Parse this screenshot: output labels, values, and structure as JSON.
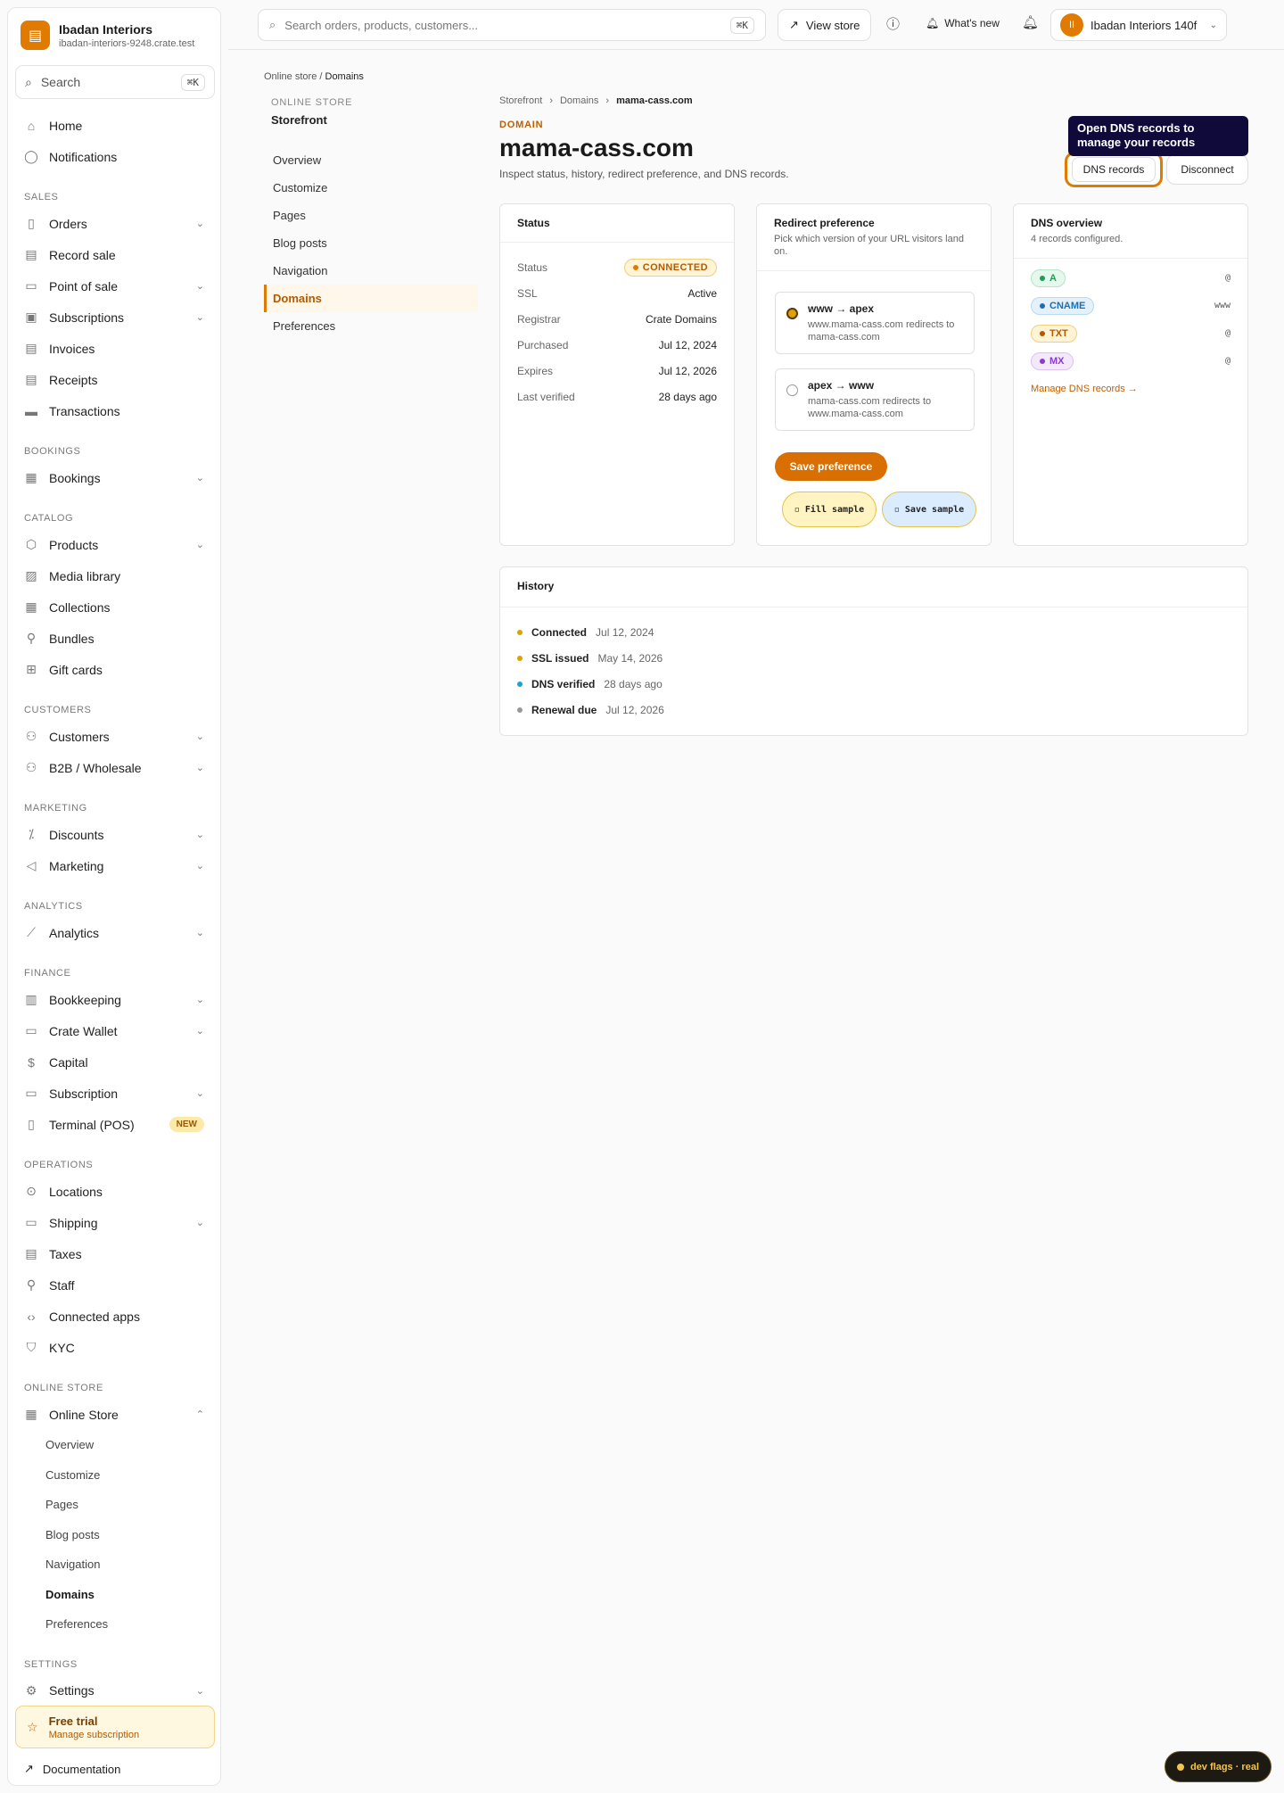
{
  "brand": {
    "name": "Ibadan Interiors",
    "subdomain": "ibadan-interiors-9248.crate.test",
    "logo_icon": "store-icon"
  },
  "sidebar_search": {
    "placeholder": "Search",
    "shortcut": "⌘K"
  },
  "sidebar": {
    "top": [
      {
        "label": "Home",
        "icon": "home-icon"
      },
      {
        "label": "Notifications",
        "icon": "bell-icon"
      }
    ],
    "sections": [
      {
        "title": "SALES",
        "items": [
          {
            "label": "Orders",
            "icon": "orders-icon",
            "chevron": true
          },
          {
            "label": "Record sale",
            "icon": "receipt-icon"
          },
          {
            "label": "Point of sale",
            "icon": "pos-icon",
            "chevron": true
          },
          {
            "label": "Subscriptions",
            "icon": "subscriptions-icon",
            "chevron": true
          },
          {
            "label": "Invoices",
            "icon": "invoice-icon"
          },
          {
            "label": "Receipts",
            "icon": "receipt-icon"
          },
          {
            "label": "Transactions",
            "icon": "transactions-icon"
          }
        ]
      },
      {
        "title": "BOOKINGS",
        "items": [
          {
            "label": "Bookings",
            "icon": "calendar-icon",
            "chevron": true
          }
        ]
      },
      {
        "title": "CATALOG",
        "items": [
          {
            "label": "Products",
            "icon": "box-icon",
            "chevron": true
          },
          {
            "label": "Media library",
            "icon": "image-icon"
          },
          {
            "label": "Collections",
            "icon": "grid-icon"
          },
          {
            "label": "Bundles",
            "icon": "bundle-icon"
          },
          {
            "label": "Gift cards",
            "icon": "gift-icon"
          }
        ]
      },
      {
        "title": "CUSTOMERS",
        "items": [
          {
            "label": "Customers",
            "icon": "users-icon",
            "chevron": true
          },
          {
            "label": "B2B / Wholesale",
            "icon": "users-icon",
            "chevron": true
          }
        ]
      },
      {
        "title": "MARKETING",
        "items": [
          {
            "label": "Discounts",
            "icon": "discount-icon",
            "chevron": true
          },
          {
            "label": "Marketing",
            "icon": "megaphone-icon",
            "chevron": true
          }
        ]
      },
      {
        "title": "ANALYTICS",
        "items": [
          {
            "label": "Analytics",
            "icon": "chart-icon",
            "chevron": true
          }
        ]
      },
      {
        "title": "FINANCE",
        "items": [
          {
            "label": "Bookkeeping",
            "icon": "ledger-icon",
            "chevron": true
          },
          {
            "label": "Crate Wallet",
            "icon": "wallet-icon",
            "chevron": true
          },
          {
            "label": "Capital",
            "icon": "dollar-icon"
          },
          {
            "label": "Subscription",
            "icon": "card-icon",
            "chevron": true
          },
          {
            "label": "Terminal (POS)",
            "icon": "terminal-icon",
            "badge": "NEW"
          }
        ]
      },
      {
        "title": "OPERATIONS",
        "items": [
          {
            "label": "Locations",
            "icon": "pin-icon"
          },
          {
            "label": "Shipping",
            "icon": "truck-icon",
            "chevron": true
          },
          {
            "label": "Taxes",
            "icon": "tax-icon"
          },
          {
            "label": "Staff",
            "icon": "user-plus-icon"
          },
          {
            "label": "Connected apps",
            "icon": "code-icon"
          },
          {
            "label": "KYC",
            "icon": "shield-icon"
          }
        ]
      },
      {
        "title": "ONLINE STORE",
        "items": [
          {
            "label": "Online Store",
            "icon": "storefront-icon",
            "chevron_up": true
          }
        ]
      }
    ],
    "online_store_sub": [
      "Overview",
      "Customize",
      "Pages",
      "Blog posts",
      "Navigation",
      "Domains",
      "Preferences"
    ],
    "settings": {
      "title": "SETTINGS",
      "label": "Settings",
      "icon": "gear-icon"
    }
  },
  "trial": {
    "title": "Free trial",
    "subtitle": "Manage subscription"
  },
  "docs": {
    "label": "Documentation"
  },
  "topbar": {
    "search_placeholder": "Search orders, products, customers...",
    "search_shortcut": "⌘K",
    "view_store": "View store",
    "whats_new": "What's new",
    "account": "Ibadan Interiors 140f",
    "avatar": "II"
  },
  "breadcrumb_top": {
    "parent": "Online store",
    "sep": "/",
    "current": "Domains"
  },
  "subnav": {
    "eyebrow": "ONLINE STORE",
    "title": "Storefront",
    "items": [
      "Overview",
      "Customize",
      "Pages",
      "Blog posts",
      "Navigation",
      "Domains",
      "Preferences"
    ],
    "active": "Domains"
  },
  "breadcrumb": {
    "a": "Storefront",
    "b": "Domains",
    "c": "mama-cass.com"
  },
  "page": {
    "eyebrow": "DOMAIN",
    "title": "mama-cass.com",
    "description": "Inspect status, history, redirect preference, and DNS records."
  },
  "tooltip": "Open DNS records to manage your records",
  "actions": {
    "dns": "DNS records",
    "disconnect": "Disconnect"
  },
  "status_card": {
    "title": "Status",
    "rows": [
      {
        "k": "Status",
        "v": "CONNECTED",
        "pill": true
      },
      {
        "k": "SSL",
        "v": "Active"
      },
      {
        "k": "Registrar",
        "v": "Crate Domains"
      },
      {
        "k": "Purchased",
        "v": "Jul 12, 2024"
      },
      {
        "k": "Expires",
        "v": "Jul 12, 2026"
      },
      {
        "k": "Last verified",
        "v": "28 days ago"
      }
    ]
  },
  "redirect_card": {
    "title": "Redirect preference",
    "subtitle": "Pick which version of your URL visitors land on.",
    "options": [
      {
        "title": "www → apex",
        "desc": "www.mama-cass.com redirects to mama-cass.com",
        "selected": true
      },
      {
        "title": "apex → www",
        "desc": "mama-cass.com redirects to www.mama-cass.com",
        "selected": false
      }
    ],
    "save": "Save preference",
    "fill": "◽ Fill sample",
    "save_sample": "◽ Save sample"
  },
  "dns_card": {
    "title": "DNS overview",
    "subtitle": "4 records configured.",
    "records": [
      {
        "type": "A",
        "value": "@",
        "color": "#1f9d55",
        "bg": "#e6f7ed",
        "border": "#b7e4c7"
      },
      {
        "type": "CNAME",
        "value": "www",
        "color": "#1d6fb0",
        "bg": "#e4f1fb",
        "border": "#b8daf2"
      },
      {
        "type": "TXT",
        "value": "@",
        "color": "#b35a00",
        "bg": "#fff4d6",
        "border": "#f2cf7d"
      },
      {
        "type": "MX",
        "value": "@",
        "color": "#8a3bc9",
        "bg": "#f3e8fc",
        "border": "#dcc1f2"
      }
    ],
    "link": "Manage DNS records →"
  },
  "history_card": {
    "title": "History",
    "items": [
      {
        "label": "Connected",
        "date": "Jul 12, 2024",
        "color": "#e0a000"
      },
      {
        "label": "SSL issued",
        "date": "May 14, 2026",
        "color": "#e0a000"
      },
      {
        "label": "DNS verified",
        "date": "28 days ago",
        "color": "#1aa3d4"
      },
      {
        "label": "Renewal due",
        "date": "Jul 12, 2026",
        "color": "#999999"
      }
    ]
  },
  "dev_flags": "dev flags · real",
  "colors": {
    "accent": "#e07b00",
    "accent_dark": "#c05e00"
  }
}
